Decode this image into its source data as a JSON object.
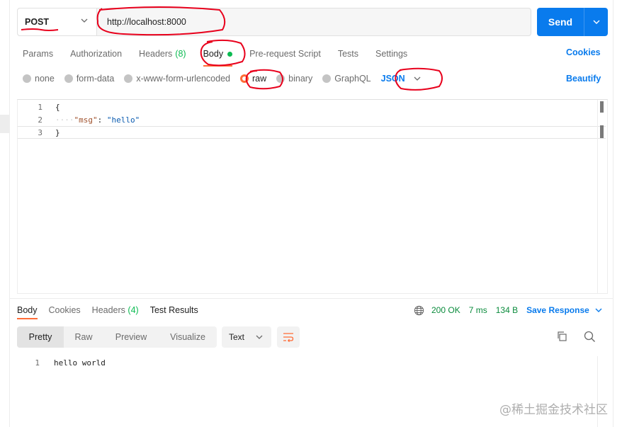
{
  "request": {
    "method": "POST",
    "url": "http://localhost:8000",
    "send_label": "Send"
  },
  "request_tabs": [
    {
      "label": "Params",
      "count": ""
    },
    {
      "label": "Authorization",
      "count": ""
    },
    {
      "label": "Headers",
      "count": "(8)"
    },
    {
      "label": "Body",
      "count": ""
    },
    {
      "label": "Pre-request Script",
      "count": ""
    },
    {
      "label": "Tests",
      "count": ""
    },
    {
      "label": "Settings",
      "count": ""
    }
  ],
  "active_request_tab": "Body",
  "cookies_label": "Cookies",
  "body_types": [
    "none",
    "form-data",
    "x-www-form-urlencoded",
    "raw",
    "binary",
    "GraphQL"
  ],
  "selected_body_type": "raw",
  "body_language": "JSON",
  "beautify_label": "Beautify",
  "editor": {
    "lines": [
      {
        "n": "1",
        "open": "{"
      },
      {
        "n": "2",
        "key": "\"msg\"",
        "sep": ": ",
        "value": "\"hello\""
      },
      {
        "n": "3",
        "close": "}"
      }
    ]
  },
  "response_tabs": [
    {
      "label": "Body",
      "count": ""
    },
    {
      "label": "Cookies",
      "count": ""
    },
    {
      "label": "Headers",
      "count": "(4)"
    },
    {
      "label": "Test Results",
      "count": ""
    }
  ],
  "active_response_tab": "Body",
  "response_meta": {
    "status": "200 OK",
    "time": "7 ms",
    "size": "134 B",
    "save_label": "Save Response"
  },
  "view_modes": [
    "Pretty",
    "Raw",
    "Preview",
    "Visualize"
  ],
  "active_view_mode": "Pretty",
  "format": "Text",
  "response_body": [
    {
      "n": "1",
      "text": "hello world"
    }
  ],
  "watermark": "@稀土掘金技术社区",
  "colors": {
    "accent": "#ff6c37",
    "link": "#097bed",
    "success": "#0cbb52",
    "annotation": "#e8001c"
  },
  "icons": [
    "chevron-down-icon",
    "globe-icon",
    "wrap-lines-icon",
    "copy-icon",
    "search-icon"
  ]
}
